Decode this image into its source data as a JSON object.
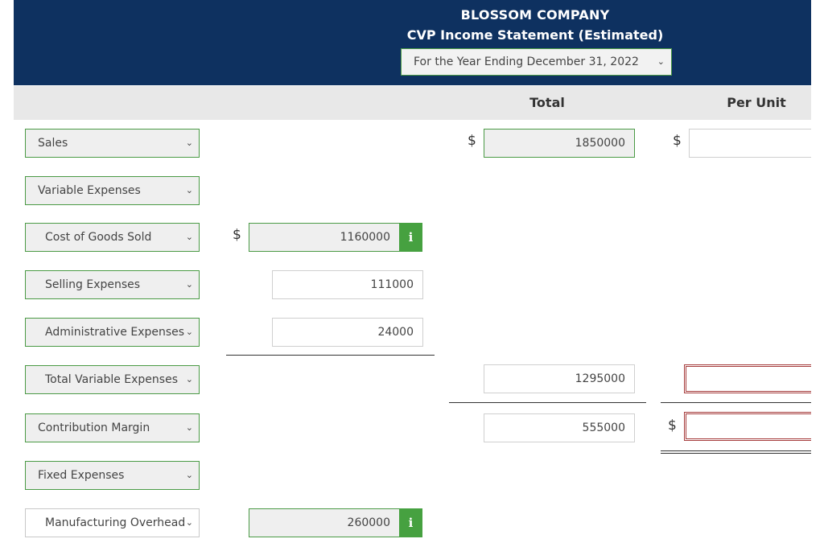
{
  "header": {
    "company": "BLOSSOM COMPANY",
    "title": "CVP Income Statement (Estimated)",
    "period": "For the Year Ending December 31, 2022"
  },
  "columns": {
    "total": "Total",
    "per_unit": "Per Unit"
  },
  "currency": "$",
  "rows": {
    "sales": {
      "label": "Sales",
      "total": "1850000",
      "per_unit": ""
    },
    "variable_expenses": {
      "label": "Variable Expenses"
    },
    "cogs": {
      "label": "Cost of Goods Sold",
      "amount": "1160000"
    },
    "selling": {
      "label": "Selling Expenses",
      "amount": "111000"
    },
    "admin": {
      "label": "Administrative Expenses",
      "amount": "24000"
    },
    "total_variable": {
      "label": "Total Variable Expenses",
      "total": "1295000",
      "per_unit": ""
    },
    "contribution_margin": {
      "label": "Contribution Margin",
      "total": "555000",
      "per_unit": ""
    },
    "fixed_expenses": {
      "label": "Fixed Expenses"
    },
    "manufacturing_overhead": {
      "label": "Manufacturing Overhead",
      "amount": "260000"
    }
  },
  "icons": {
    "info": "i"
  },
  "colors": {
    "header_bg": "#0e3160",
    "accent_green": "#46a140",
    "error_red": "#a53b3b"
  }
}
